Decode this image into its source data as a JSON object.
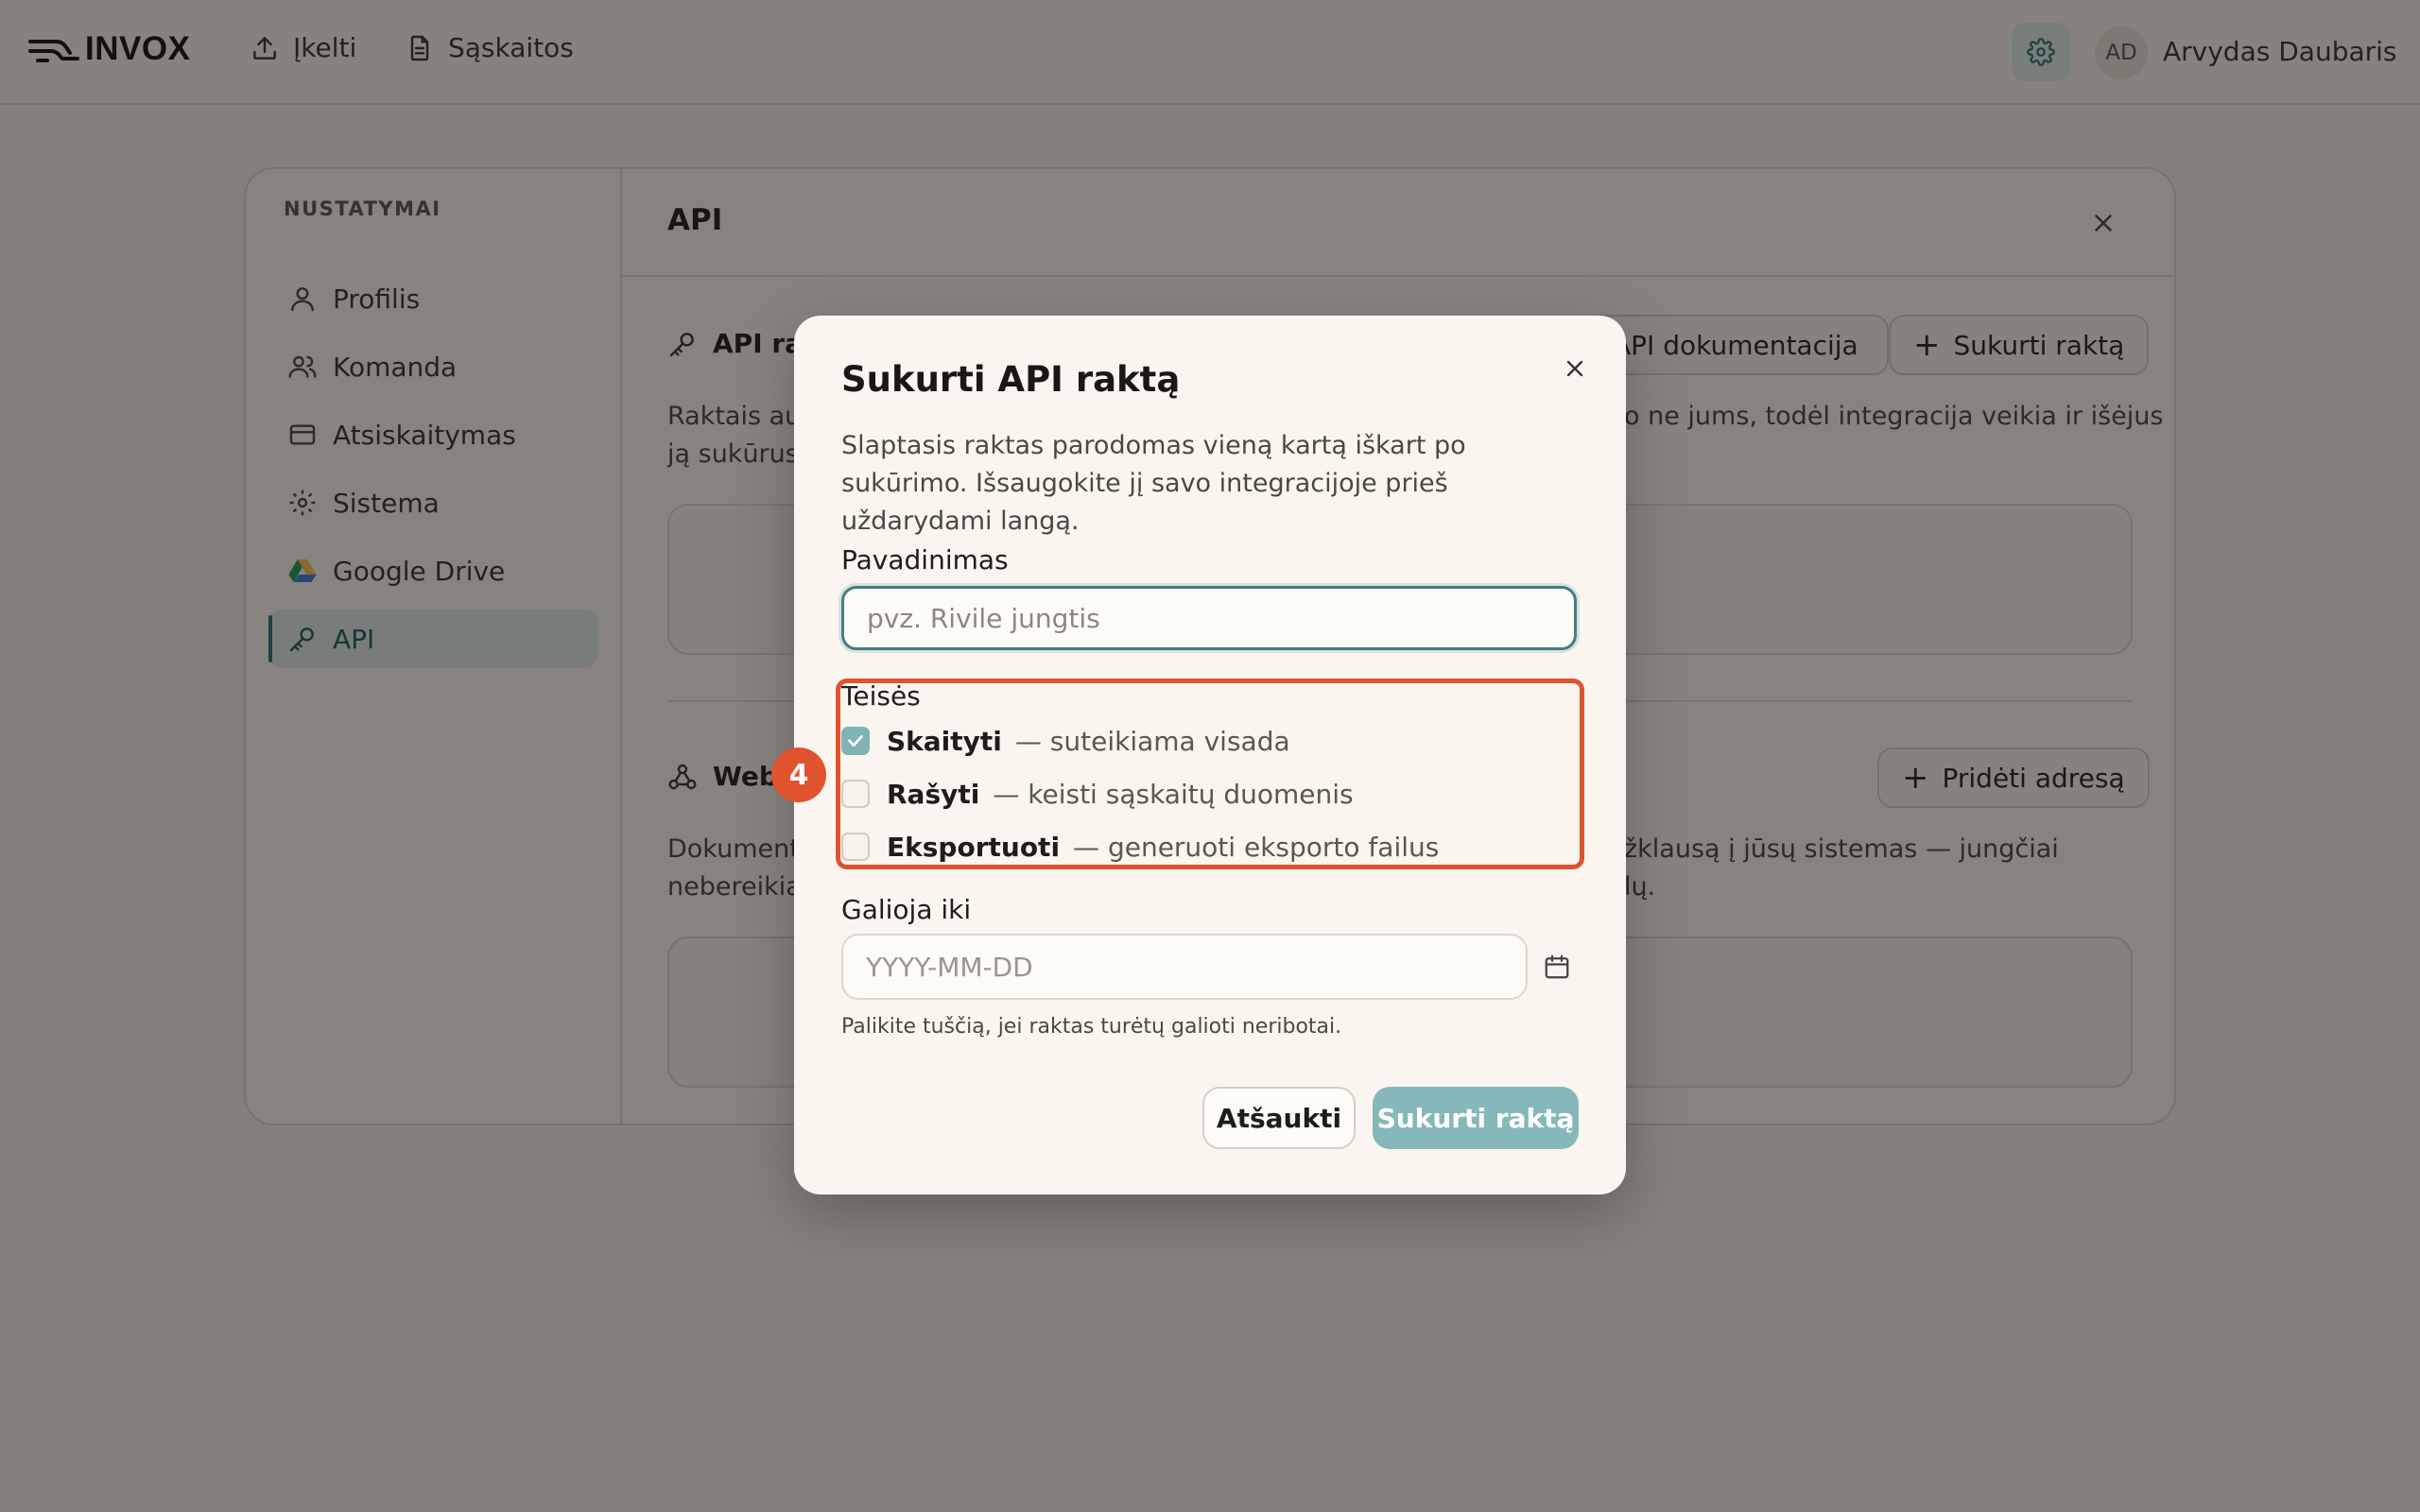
{
  "app": {
    "logo": "INVOX"
  },
  "nav": {
    "upload": "Įkelti",
    "invoices": "Sąskaitos"
  },
  "user": {
    "initials": "AD",
    "name": "Arvydas Daubaris"
  },
  "settings": {
    "title": "NUSTATYMAI",
    "items": [
      {
        "label": "Profilis",
        "icon": "user-icon"
      },
      {
        "label": "Komanda",
        "icon": "users-icon"
      },
      {
        "label": "Atsiskaitymas",
        "icon": "credit-card-icon"
      },
      {
        "label": "Sistema",
        "icon": "gear-icon"
      },
      {
        "label": "Google Drive",
        "icon": "google-drive-icon"
      },
      {
        "label": "API",
        "icon": "key-icon",
        "active": true
      }
    ]
  },
  "main": {
    "title": "API",
    "api_keys": {
      "title": "API rak",
      "docs_button": "API dokumentacija",
      "create_button": "Sukurti raktą",
      "text_left_1": "Raktais au",
      "text_left_2": "ją sukūrus",
      "text_right_1": "o ne jums, todėl integracija veikia ir išėjus"
    },
    "webhooks": {
      "title": "Webl",
      "add_button": "Pridėti adresą",
      "text_left_1": "Dokument",
      "text_left_2": "nebereikia",
      "text_right_1": "žklausą į jūsų sistemas — jungčiai",
      "text_right_2": "lų."
    }
  },
  "dialog": {
    "title": "Sukurti API raktą",
    "description": "Slaptasis raktas parodomas vieną kartą iškart po sukūrimo. Išsaugokite jį savo integracijoje prieš uždarydami langą.",
    "name_label": "Pavadinimas",
    "name_placeholder": "pvz. Rivile jungtis",
    "permissions_label": "Teisės",
    "permissions": [
      {
        "name": "Skaityti",
        "desc": "— suteikiama visada",
        "checked": true
      },
      {
        "name": "Rašyti",
        "desc": "— keisti sąskaitų duomenis",
        "checked": false
      },
      {
        "name": "Eksportuoti",
        "desc": "— generuoti eksporto failus",
        "checked": false
      }
    ],
    "expiry_label": "Galioja iki",
    "expiry_placeholder": "YYYY-MM-DD",
    "expiry_hint": "Palikite tuščią, jei raktas turėtų galioti neribotai.",
    "cancel": "Atšaukti",
    "submit": "Sukurti raktą"
  },
  "annotation": {
    "step": "4"
  },
  "colors": {
    "accent": "#3f7f84",
    "highlight": "#e0532e",
    "submit_disabled": "#86b8bb"
  }
}
